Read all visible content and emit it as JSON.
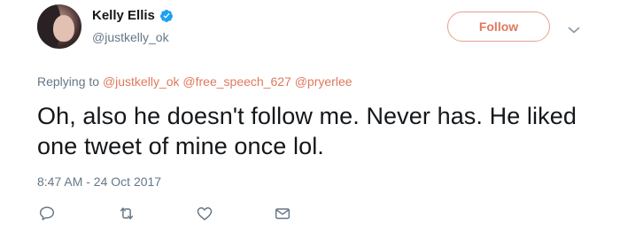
{
  "user": {
    "display_name": "Kelly Ellis",
    "handle": "@justkelly_ok",
    "verified": true,
    "avatar": "profile-photo"
  },
  "follow_button": {
    "label": "Follow"
  },
  "more_menu": {
    "icon": "chevron-down-icon"
  },
  "replying_to": {
    "prefix": "Replying to",
    "mentions": [
      "@justkelly_ok",
      "@free_speech_627",
      "@pryerlee"
    ]
  },
  "tweet": {
    "text": "Oh, also he doesn't follow me. Never has. He liked one tweet of mine once lol.",
    "timestamp": "8:47 AM - 24 Oct 2017"
  },
  "actions": [
    {
      "name": "reply",
      "icon": "reply-icon"
    },
    {
      "name": "retweet",
      "icon": "retweet-icon"
    },
    {
      "name": "like",
      "icon": "heart-icon"
    },
    {
      "name": "message",
      "icon": "envelope-icon"
    }
  ],
  "colors": {
    "accent": "#e0785c",
    "text": "#14171a",
    "secondary": "#657786",
    "verified": "#1da1f2"
  }
}
